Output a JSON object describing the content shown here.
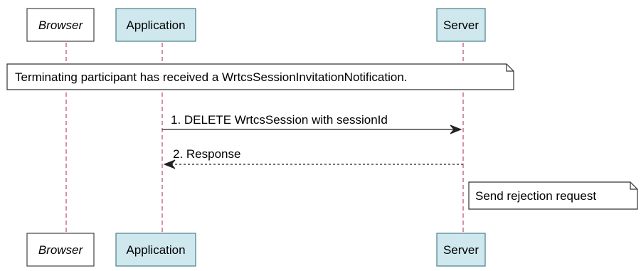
{
  "participants": {
    "browser": {
      "label": "Browser",
      "style": "actor-italic"
    },
    "application": {
      "label": "Application",
      "style": "boxed"
    },
    "server": {
      "label": "Server",
      "style": "boxed"
    }
  },
  "notes": {
    "terminating": "Terminating participant has received a WrtcsSessionInvitationNotification.",
    "rejection": "Send rejection request"
  },
  "messages": [
    {
      "label": "1. DELETE WrtcsSession with sessionId",
      "from": "application",
      "to": "server",
      "line": "solid"
    },
    {
      "label": "2. Response",
      "from": "server",
      "to": "application",
      "line": "dashed"
    }
  ],
  "colors": {
    "participant_fill": "#CFE8EE",
    "participant_stroke": "#4A7F8C",
    "lifeline": "#B0204A",
    "note_fill": "#FFFFFF",
    "note_stroke": "#333333",
    "arrow": "#222222"
  }
}
